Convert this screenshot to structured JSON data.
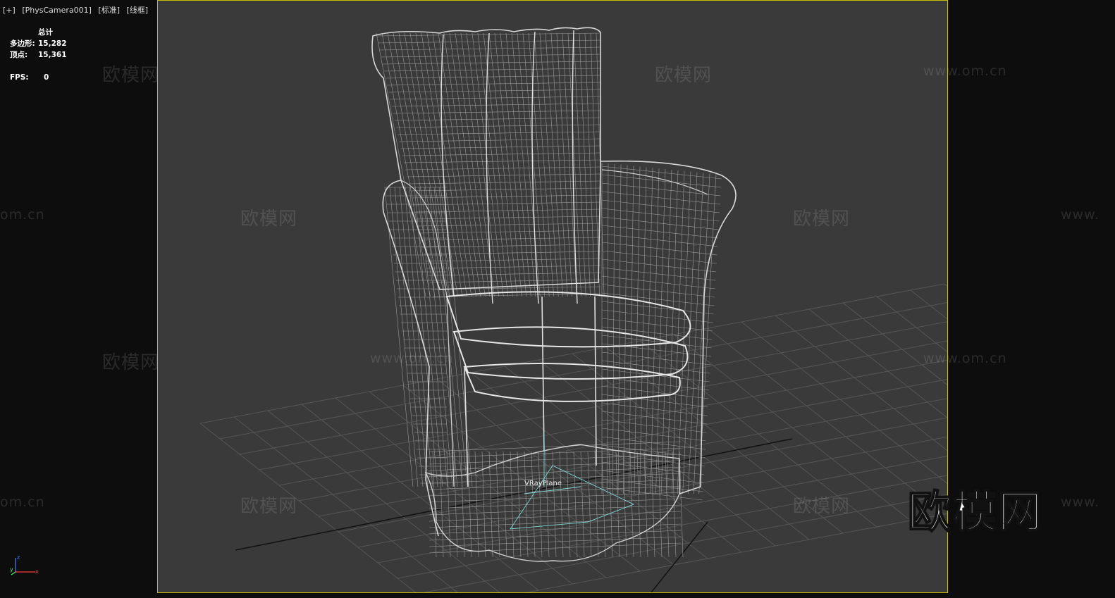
{
  "viewport_menu": {
    "plus": "[+]",
    "camera": "[PhysCamera001]",
    "shading": "[标准]",
    "mode": "[线框]"
  },
  "stats": {
    "total_label": "总计",
    "polygons_label": "多边形:",
    "polygons_value": "15,282",
    "vertices_label": "顶点:",
    "vertices_value": "15,361",
    "fps_label": "FPS:",
    "fps_value": "0"
  },
  "scene": {
    "object_label": "VRayPlane"
  },
  "watermarks": {
    "cn": "欧模网",
    "url": "www.om.cn",
    "url_partial": "om.cn",
    "url_left": "www."
  },
  "logo": "欧模网",
  "axis": {
    "x": "x",
    "y": "y",
    "z": "z"
  },
  "colors": {
    "viewport_border": "#c9c100",
    "viewport_bg": "#3a3a3a",
    "wireframe": "#d0d0d0",
    "vrayplane": "#7fd6d6"
  }
}
